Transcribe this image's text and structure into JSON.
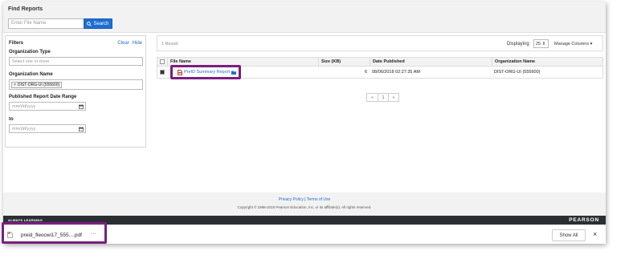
{
  "find_reports": {
    "title": "Find Reports",
    "search_placeholder": "Enter File Name",
    "search_button": "Search"
  },
  "filters": {
    "title": "Filters",
    "clear": "Clear",
    "hide": "Hide",
    "org_type_label": "Organization Type",
    "org_type_placeholder": "Select one or more",
    "org_name_label": "Organization Name",
    "org_name_chip": "DIST-ORG-UI (555600)",
    "chip_remove": "×",
    "date_range_label": "Published Report Date Range",
    "date_from_placeholder": "mm/dd/yyyy",
    "to_label": "to",
    "date_to_placeholder": "mm/dd/yyyy"
  },
  "results": {
    "count": "1 Result",
    "displaying_label": "Displaying",
    "displaying_value": "25",
    "manage_columns": "Manage Columns",
    "columns": [
      "File Name",
      "Size (KB)",
      "Date Published",
      "Organization Name"
    ],
    "rows": [
      {
        "file_name": "PreID Summary Report",
        "size_kb": "6",
        "date_published": "08/06/2018 02:27:35 AM",
        "organization": "DIST-ORG-UI (555600)",
        "checked": true
      }
    ],
    "pager": [
      "«",
      "1",
      "»"
    ]
  },
  "footer": {
    "privacy": "Privacy Policy",
    "separator": "|",
    "terms": "Terms of Use",
    "copyright": "Copyright © 1998-2015 Pearson Education, Inc. or its affiliate(s). All rights reserved.",
    "tagline": "ALWAYS LEARNING",
    "brand": "PEARSON"
  },
  "download_bar": {
    "file_name": "preid_fleocwi17_555....pdf",
    "more": "···",
    "show_all": "Show All",
    "close": "×"
  },
  "colors": {
    "accent": "#1f6ed1",
    "highlight": "#7b1f7f",
    "brand_bar": "#2b2f33"
  }
}
